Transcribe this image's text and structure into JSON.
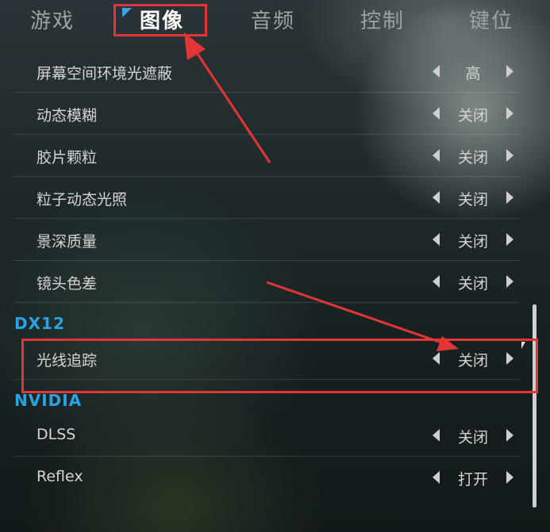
{
  "tabs": [
    "游戏",
    "图像",
    "音频",
    "控制",
    "键位"
  ],
  "active_tab_index": 1,
  "rows_top": [
    {
      "label": "屏幕空间环境光遮蔽",
      "value": "高"
    },
    {
      "label": "动态模糊",
      "value": "关闭"
    },
    {
      "label": "胶片颗粒",
      "value": "关闭"
    },
    {
      "label": "粒子动态光照",
      "value": "关闭"
    },
    {
      "label": "景深质量",
      "value": "关闭"
    },
    {
      "label": "镜头色差",
      "value": "关闭"
    }
  ],
  "section_dx12": {
    "title": "DX12",
    "rows": [
      {
        "label": "光线追踪",
        "value": "关闭"
      }
    ]
  },
  "section_nvidia": {
    "title": "NVIDIA",
    "rows": [
      {
        "label": "DLSS",
        "value": "关闭"
      },
      {
        "label": "Reflex",
        "value": "打开"
      }
    ]
  },
  "colors": {
    "accent": "#2aa3e0",
    "annotation": "#e33535"
  }
}
